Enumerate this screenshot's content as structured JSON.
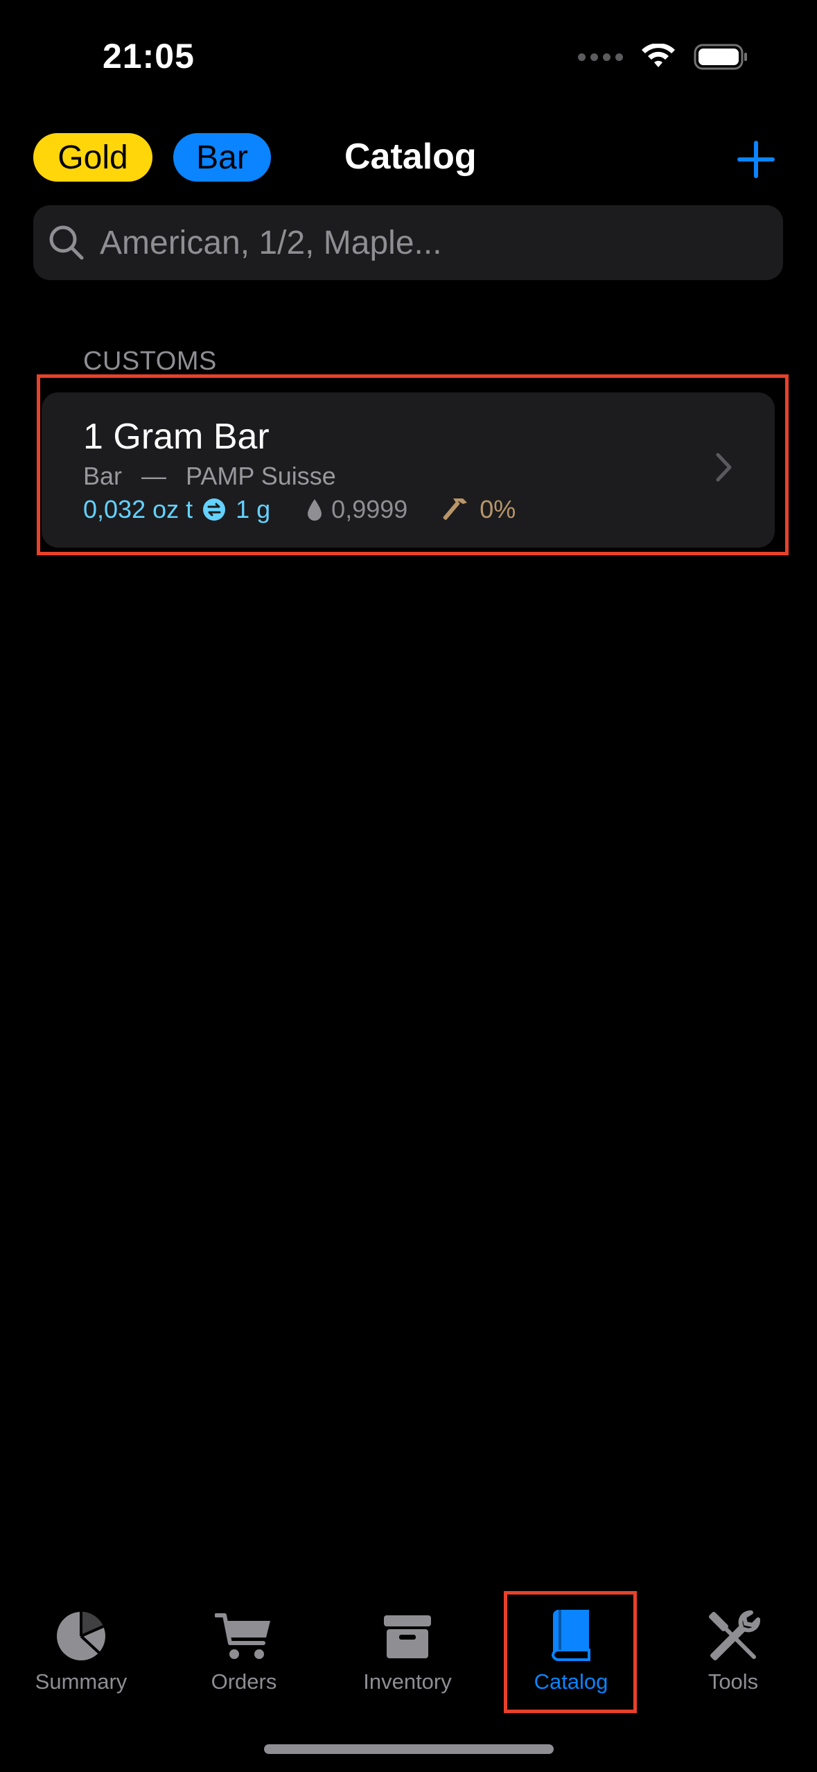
{
  "status_bar": {
    "time": "21:05"
  },
  "header": {
    "metal_filter": "Gold",
    "type_filter": "Bar",
    "title": "Catalog",
    "add_icon": "plus-icon"
  },
  "search": {
    "placeholder": "American, 1/2, Maple...",
    "value": ""
  },
  "section": {
    "title": "CUSTOMS",
    "items": [
      {
        "name": "1 Gram Bar",
        "type": "Bar",
        "separator": "—",
        "mint": "PAMP Suisse",
        "weight_oz": "0,032 oz t",
        "weight_g": "1 g",
        "purity": "0,9999",
        "premium": "0%"
      }
    ]
  },
  "tab_bar": {
    "tabs": [
      {
        "label": "Summary",
        "icon": "pie-chart-icon"
      },
      {
        "label": "Orders",
        "icon": "cart-icon"
      },
      {
        "label": "Inventory",
        "icon": "archive-box-icon"
      },
      {
        "label": "Catalog",
        "icon": "book-icon"
      },
      {
        "label": "Tools",
        "icon": "tools-icon"
      }
    ],
    "selected": "Catalog"
  },
  "colors": {
    "gold": "#FFD60A",
    "accent_blue": "#0A84FF",
    "highlight": "#E8412A",
    "weight_blue": "#64D2FF",
    "premium_tan": "#B8966A"
  }
}
